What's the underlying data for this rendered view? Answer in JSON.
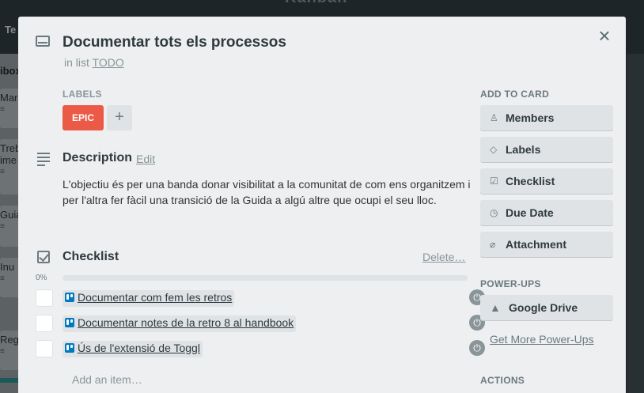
{
  "background": {
    "board_title": "Kanban",
    "tab_text": "Te",
    "list_title": "ibox",
    "cards": [
      "Marca",
      "Treba",
      "ime",
      "Guia",
      "Inu",
      "Regis"
    ]
  },
  "modal": {
    "title": "Documentar tots els processos",
    "in_list_prefix": "in list",
    "list_name": "TODO",
    "close_label": "×"
  },
  "labels": {
    "heading": "LABELS",
    "items": [
      {
        "text": "EPIC",
        "color": "#eb5a46"
      }
    ],
    "add_label": "+"
  },
  "description": {
    "heading": "Description",
    "edit_label": "Edit",
    "text": "L'objectiu és per una banda donar visibilitat a la comunitat de com ens organitzem i per l'altra fer fàcil una transició de la Guida a algú altre que ocupi el seu lloc."
  },
  "checklist": {
    "heading": "Checklist",
    "delete_label": "Delete…",
    "progress_text": "0%",
    "progress_value": 0,
    "items": [
      {
        "text": "Documentar com fem les retros",
        "checked": false
      },
      {
        "text": "Documentar notes de la retro 8 al handbook",
        "checked": false
      },
      {
        "text": "Ús de l'extensió de Toggl",
        "checked": false
      }
    ],
    "add_item_placeholder": "Add an item…"
  },
  "sidebar": {
    "add_to_card_heading": "ADD TO CARD",
    "add_buttons": [
      {
        "label": "Members",
        "icon": "person-icon"
      },
      {
        "label": "Labels",
        "icon": "tag-icon"
      },
      {
        "label": "Checklist",
        "icon": "checkbox-icon"
      },
      {
        "label": "Due Date",
        "icon": "clock-icon"
      },
      {
        "label": "Attachment",
        "icon": "paperclip-icon"
      }
    ],
    "power_ups_heading": "POWER-UPS",
    "power_ups": [
      {
        "label": "Google Drive",
        "icon": "google-drive-icon"
      }
    ],
    "get_more_label": "Get More Power-Ups",
    "actions_heading": "ACTIONS"
  },
  "colors": {
    "label_epic": "#eb5a46",
    "trello_blue": "#0079bf",
    "modal_bg": "#edeff0",
    "button_bg": "#dfe3e5"
  }
}
